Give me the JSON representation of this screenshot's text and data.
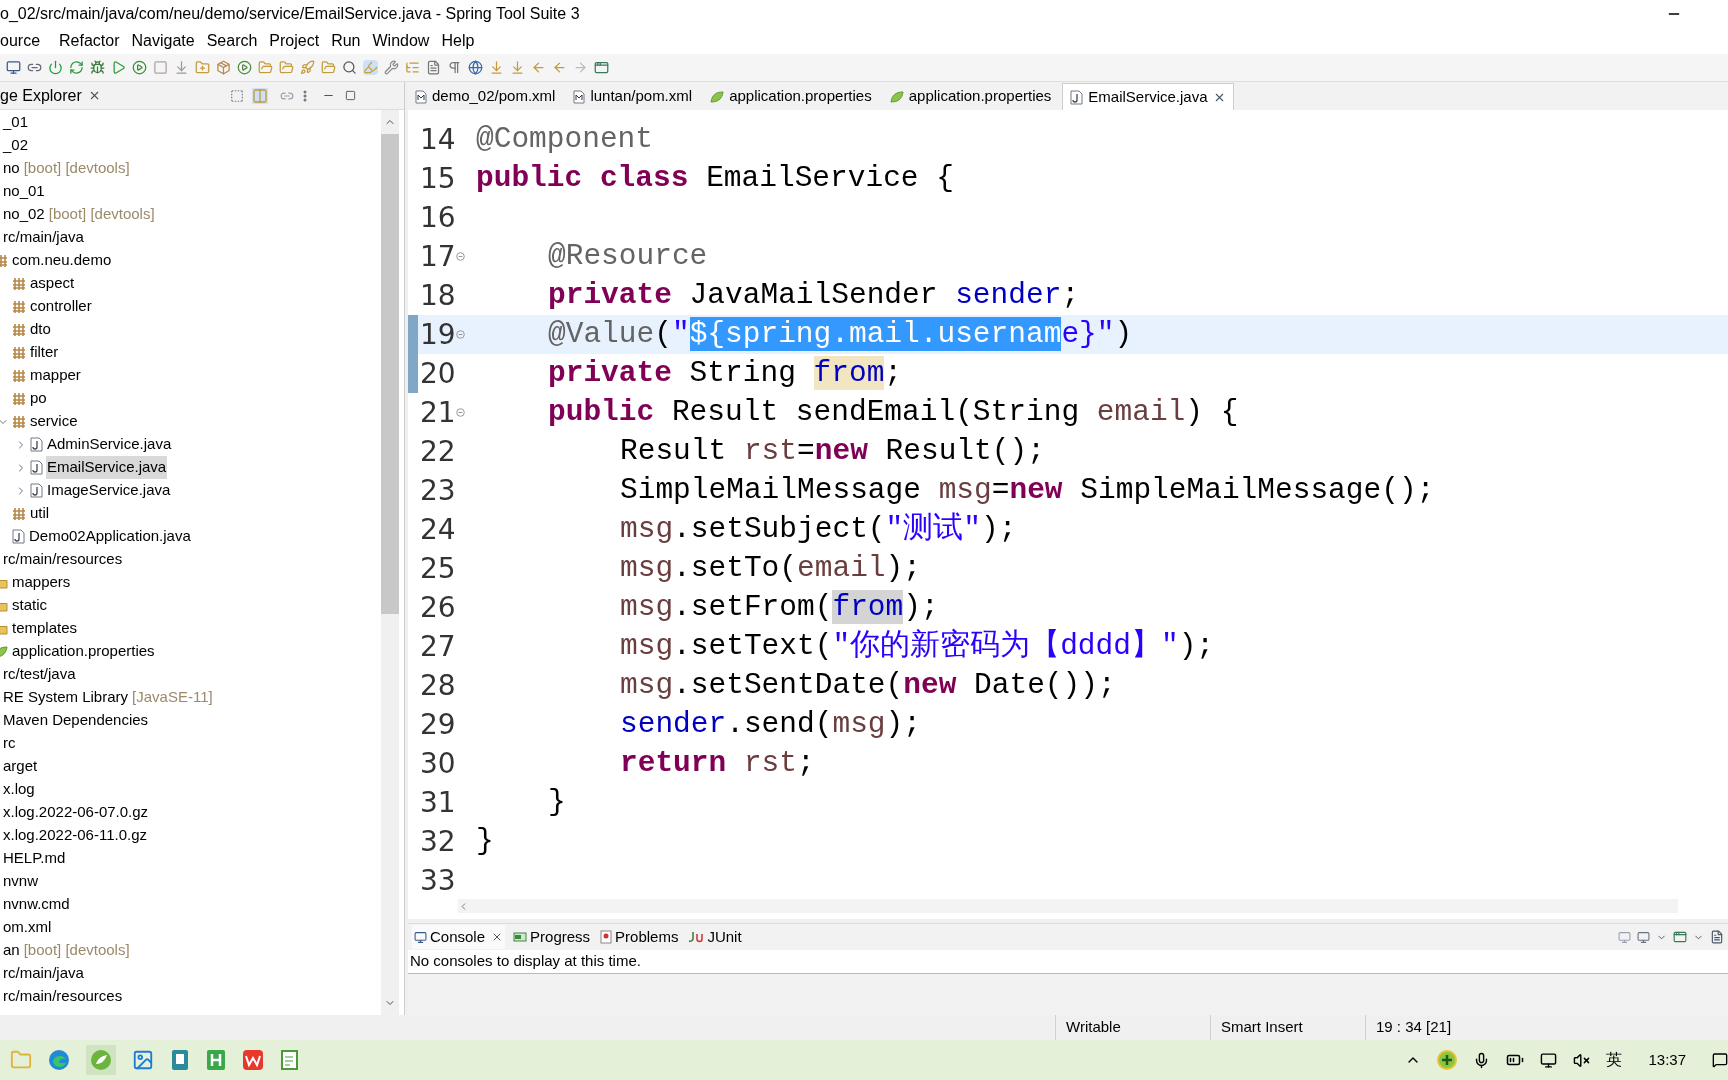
{
  "window": {
    "title": "o_02/src/main/java/com/neu/demo/service/EmailService.java - Spring Tool Suite 3"
  },
  "menu": [
    "ource",
    "Refactor",
    "Navigate",
    "Search",
    "Project",
    "Run",
    "Window",
    "Help"
  ],
  "explorer": {
    "title": "ge Explorer",
    "items": [
      {
        "text": "_01"
      },
      {
        "text": "_02"
      },
      {
        "text": "no",
        "decoration": "[boot] [devtools]"
      },
      {
        "text": "no_01"
      },
      {
        "text": "no_02",
        "decoration": "[boot] [devtools]"
      },
      {
        "text": "rc/main/java",
        "children": [
          {
            "text": "com.neu.demo",
            "kind": "package",
            "children": [
              {
                "text": "aspect",
                "kind": "package"
              },
              {
                "text": "controller",
                "kind": "package"
              },
              {
                "text": "dto",
                "kind": "package"
              },
              {
                "text": "filter",
                "kind": "package"
              },
              {
                "text": "mapper",
                "kind": "package"
              },
              {
                "text": "po",
                "kind": "package"
              },
              {
                "text": "service",
                "kind": "package",
                "expanded": true,
                "children": [
                  {
                    "text": "AdminService.java",
                    "kind": "java",
                    "expanded": false,
                    "selected": false
                  },
                  {
                    "text": "EmailService.java",
                    "kind": "java",
                    "expanded": false,
                    "selected": true
                  },
                  {
                    "text": "ImageService.java",
                    "kind": "java",
                    "expanded": false,
                    "selected": false
                  }
                ]
              },
              {
                "text": "util",
                "kind": "package"
              },
              {
                "text": "Demo02Application.java",
                "kind": "java"
              }
            ]
          }
        ]
      },
      {
        "text": "rc/main/resources",
        "children": [
          {
            "text": "mappers",
            "kind": "folder"
          },
          {
            "text": "static",
            "kind": "folder"
          },
          {
            "text": "templates",
            "kind": "folder"
          },
          {
            "text": "application.properties",
            "kind": "properties"
          }
        ]
      },
      {
        "text": "rc/test/java"
      },
      {
        "text": "RE System Library",
        "decoration": "[JavaSE-11]"
      },
      {
        "text": "Maven Dependencies"
      },
      {
        "text": "rc"
      },
      {
        "text": "arget"
      },
      {
        "text": "x.log"
      },
      {
        "text": "x.log.2022-06-07.0.gz"
      },
      {
        "text": "x.log.2022-06-11.0.gz"
      },
      {
        "text": "HELP.md"
      },
      {
        "text": "nvnw"
      },
      {
        "text": "nvnw.cmd"
      },
      {
        "text": "om.xml"
      },
      {
        "text": "an",
        "decoration": "[boot] [devtools]"
      },
      {
        "text": "rc/main/java"
      },
      {
        "text": "rc/main/resources"
      }
    ]
  },
  "editor_tabs": [
    {
      "label": "demo_02/pom.xml",
      "kind": "maven",
      "selected": false
    },
    {
      "label": "luntan/pom.xml",
      "kind": "maven",
      "selected": false
    },
    {
      "label": "application.properties",
      "kind": "properties",
      "selected": false
    },
    {
      "label": "application.properties",
      "kind": "properties",
      "selected": false
    },
    {
      "label": "EmailService.java",
      "kind": "java",
      "selected": true
    }
  ],
  "code": [
    {
      "number": "14",
      "tokens": [
        {
          "text": "@Component",
          "kind": "ann"
        }
      ]
    },
    {
      "number": "15",
      "tokens": [
        {
          "text": "public",
          "kind": "kw"
        },
        {
          "text": " class",
          "kind": "kw"
        },
        {
          "text": " EmailService {",
          "kind": "plain"
        }
      ],
      "children": [
        {
          "number": "16"
        },
        {
          "number": "17",
          "foldable": true,
          "tokens": [
            {
              "text": "@Resource",
              "kind": "ann"
            }
          ]
        },
        {
          "number": "18",
          "tokens": [
            {
              "text": "private",
              "kind": "kw"
            },
            {
              "text": " JavaMailSender ",
              "kind": "plain"
            },
            {
              "text": "sender",
              "kind": "field"
            },
            {
              "text": ";",
              "kind": "plain"
            }
          ]
        },
        {
          "number": "19",
          "foldable": true,
          "current": true,
          "changed": true,
          "tokens": [
            {
              "text": "@Value",
              "kind": "ann"
            },
            {
              "text": "(",
              "kind": "plain"
            },
            {
              "text": "\"",
              "kind": "str"
            },
            {
              "text": "${spring.mail.usernam",
              "kind": "sel"
            },
            {
              "text": "e}\"",
              "kind": "str"
            },
            {
              "text": ")",
              "kind": "plain"
            }
          ]
        },
        {
          "number": "20",
          "changed": true,
          "tokens": [
            {
              "text": "private",
              "kind": "kw"
            },
            {
              "text": " String ",
              "kind": "plain"
            },
            {
              "text": "from",
              "kind": "field",
              "write_occurrence": true
            },
            {
              "text": ";",
              "kind": "plain"
            }
          ]
        },
        {
          "number": "21",
          "foldable": true,
          "tokens": [
            {
              "text": "public",
              "kind": "kw"
            },
            {
              "text": " Result sendEmail(String ",
              "kind": "plain"
            },
            {
              "text": "email",
              "kind": "local"
            },
            {
              "text": ") {",
              "kind": "plain"
            }
          ],
          "children": [
            {
              "number": "22",
              "tokens": [
                {
                  "text": "Result ",
                  "kind": "plain"
                },
                {
                  "text": "rst",
                  "kind": "local"
                },
                {
                  "text": "=",
                  "kind": "plain"
                },
                {
                  "text": "new",
                  "kind": "kw"
                },
                {
                  "text": " Result();",
                  "kind": "plain"
                }
              ]
            },
            {
              "number": "23",
              "tokens": [
                {
                  "text": "SimpleMailMessage ",
                  "kind": "plain"
                },
                {
                  "text": "msg",
                  "kind": "local"
                },
                {
                  "text": "=",
                  "kind": "plain"
                },
                {
                  "text": "new",
                  "kind": "kw"
                },
                {
                  "text": " SimpleMailMessage();",
                  "kind": "plain"
                }
              ]
            },
            {
              "number": "24",
              "tokens": [
                {
                  "text": "msg",
                  "kind": "local"
                },
                {
                  "text": ".setSubject(",
                  "kind": "plain"
                },
                {
                  "text": "\"测试\"",
                  "kind": "str"
                },
                {
                  "text": ");",
                  "kind": "plain"
                }
              ]
            },
            {
              "number": "25",
              "tokens": [
                {
                  "text": "msg",
                  "kind": "local"
                },
                {
                  "text": ".setTo(",
                  "kind": "plain"
                },
                {
                  "text": "email",
                  "kind": "local"
                },
                {
                  "text": ");",
                  "kind": "plain"
                }
              ]
            },
            {
              "number": "26",
              "tokens": [
                {
                  "text": "msg",
                  "kind": "local"
                },
                {
                  "text": ".setFrom(",
                  "kind": "plain"
                },
                {
                  "text": "from",
                  "kind": "field",
                  "read_occurrence": true
                },
                {
                  "text": ");",
                  "kind": "plain"
                }
              ]
            },
            {
              "number": "27",
              "tokens": [
                {
                  "text": "msg",
                  "kind": "local"
                },
                {
                  "text": ".setText(",
                  "kind": "plain"
                },
                {
                  "text": "\"你的新密码为【dddd】\"",
                  "kind": "str"
                },
                {
                  "text": ");",
                  "kind": "plain"
                }
              ]
            },
            {
              "number": "28",
              "tokens": [
                {
                  "text": "msg",
                  "kind": "local"
                },
                {
                  "text": ".setSentDate(",
                  "kind": "plain"
                },
                {
                  "text": "new",
                  "kind": "kw"
                },
                {
                  "text": " Date());",
                  "kind": "plain"
                }
              ]
            },
            {
              "number": "29",
              "tokens": [
                {
                  "text": "sender",
                  "kind": "field"
                },
                {
                  "text": ".send(",
                  "kind": "plain"
                },
                {
                  "text": "msg",
                  "kind": "local"
                },
                {
                  "text": ");",
                  "kind": "plain"
                }
              ]
            },
            {
              "number": "30",
              "tokens": [
                {
                  "text": "return",
                  "kind": "kw"
                },
                {
                  "text": " rst",
                  "kind": "local"
                },
                {
                  "text": ";",
                  "kind": "plain"
                }
              ]
            }
          ]
        },
        {
          "number": "31",
          "tokens": [
            {
              "text": "}",
              "kind": "plain"
            }
          ]
        }
      ]
    },
    {
      "number": "32",
      "tokens": [
        {
          "text": "}",
          "kind": "plain"
        }
      ]
    },
    {
      "number": "33"
    }
  ],
  "console": {
    "tabs": [
      {
        "label": "Console",
        "kind": "console",
        "selected": true
      },
      {
        "label": "Progress",
        "kind": "progress",
        "selected": false
      },
      {
        "label": "Problems",
        "kind": "problems",
        "selected": false
      },
      {
        "label": "JUnit",
        "kind": "junit",
        "selected": false
      }
    ],
    "message": "No consoles to display at this time."
  },
  "status_bar": [
    "Writable",
    "Smart Insert",
    "19 : 34 [21]"
  ],
  "taskbar": {
    "input_method": "英",
    "time": "13:37"
  }
}
